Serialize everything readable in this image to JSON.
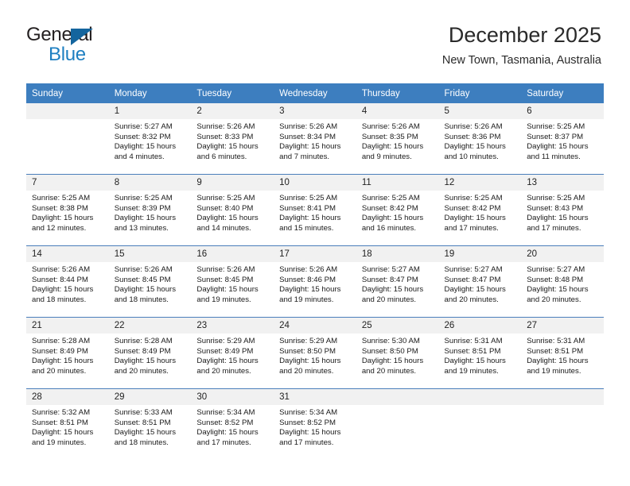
{
  "brand": {
    "name_part1": "General",
    "name_part2": "Blue",
    "triangle_color": "#14659e",
    "blue_color": "#1e7fc1"
  },
  "header": {
    "title": "December 2025",
    "subtitle": "New Town, Tasmania, Australia"
  },
  "theme": {
    "header_blue": "#3d7ebf",
    "row_divider": "#4a7ebb",
    "daynum_band": "#f1f1f1"
  },
  "calendar": {
    "weekday_headers": [
      "Sunday",
      "Monday",
      "Tuesday",
      "Wednesday",
      "Thursday",
      "Friday",
      "Saturday"
    ],
    "weeks": [
      [
        {
          "day": "",
          "sunrise": "",
          "sunset": "",
          "daylight1": "",
          "daylight2": ""
        },
        {
          "day": "1",
          "sunrise": "Sunrise: 5:27 AM",
          "sunset": "Sunset: 8:32 PM",
          "daylight1": "Daylight: 15 hours",
          "daylight2": "and 4 minutes."
        },
        {
          "day": "2",
          "sunrise": "Sunrise: 5:26 AM",
          "sunset": "Sunset: 8:33 PM",
          "daylight1": "Daylight: 15 hours",
          "daylight2": "and 6 minutes."
        },
        {
          "day": "3",
          "sunrise": "Sunrise: 5:26 AM",
          "sunset": "Sunset: 8:34 PM",
          "daylight1": "Daylight: 15 hours",
          "daylight2": "and 7 minutes."
        },
        {
          "day": "4",
          "sunrise": "Sunrise: 5:26 AM",
          "sunset": "Sunset: 8:35 PM",
          "daylight1": "Daylight: 15 hours",
          "daylight2": "and 9 minutes."
        },
        {
          "day": "5",
          "sunrise": "Sunrise: 5:26 AM",
          "sunset": "Sunset: 8:36 PM",
          "daylight1": "Daylight: 15 hours",
          "daylight2": "and 10 minutes."
        },
        {
          "day": "6",
          "sunrise": "Sunrise: 5:25 AM",
          "sunset": "Sunset: 8:37 PM",
          "daylight1": "Daylight: 15 hours",
          "daylight2": "and 11 minutes."
        }
      ],
      [
        {
          "day": "7",
          "sunrise": "Sunrise: 5:25 AM",
          "sunset": "Sunset: 8:38 PM",
          "daylight1": "Daylight: 15 hours",
          "daylight2": "and 12 minutes."
        },
        {
          "day": "8",
          "sunrise": "Sunrise: 5:25 AM",
          "sunset": "Sunset: 8:39 PM",
          "daylight1": "Daylight: 15 hours",
          "daylight2": "and 13 minutes."
        },
        {
          "day": "9",
          "sunrise": "Sunrise: 5:25 AM",
          "sunset": "Sunset: 8:40 PM",
          "daylight1": "Daylight: 15 hours",
          "daylight2": "and 14 minutes."
        },
        {
          "day": "10",
          "sunrise": "Sunrise: 5:25 AM",
          "sunset": "Sunset: 8:41 PM",
          "daylight1": "Daylight: 15 hours",
          "daylight2": "and 15 minutes."
        },
        {
          "day": "11",
          "sunrise": "Sunrise: 5:25 AM",
          "sunset": "Sunset: 8:42 PM",
          "daylight1": "Daylight: 15 hours",
          "daylight2": "and 16 minutes."
        },
        {
          "day": "12",
          "sunrise": "Sunrise: 5:25 AM",
          "sunset": "Sunset: 8:42 PM",
          "daylight1": "Daylight: 15 hours",
          "daylight2": "and 17 minutes."
        },
        {
          "day": "13",
          "sunrise": "Sunrise: 5:25 AM",
          "sunset": "Sunset: 8:43 PM",
          "daylight1": "Daylight: 15 hours",
          "daylight2": "and 17 minutes."
        }
      ],
      [
        {
          "day": "14",
          "sunrise": "Sunrise: 5:26 AM",
          "sunset": "Sunset: 8:44 PM",
          "daylight1": "Daylight: 15 hours",
          "daylight2": "and 18 minutes."
        },
        {
          "day": "15",
          "sunrise": "Sunrise: 5:26 AM",
          "sunset": "Sunset: 8:45 PM",
          "daylight1": "Daylight: 15 hours",
          "daylight2": "and 18 minutes."
        },
        {
          "day": "16",
          "sunrise": "Sunrise: 5:26 AM",
          "sunset": "Sunset: 8:45 PM",
          "daylight1": "Daylight: 15 hours",
          "daylight2": "and 19 minutes."
        },
        {
          "day": "17",
          "sunrise": "Sunrise: 5:26 AM",
          "sunset": "Sunset: 8:46 PM",
          "daylight1": "Daylight: 15 hours",
          "daylight2": "and 19 minutes."
        },
        {
          "day": "18",
          "sunrise": "Sunrise: 5:27 AM",
          "sunset": "Sunset: 8:47 PM",
          "daylight1": "Daylight: 15 hours",
          "daylight2": "and 20 minutes."
        },
        {
          "day": "19",
          "sunrise": "Sunrise: 5:27 AM",
          "sunset": "Sunset: 8:47 PM",
          "daylight1": "Daylight: 15 hours",
          "daylight2": "and 20 minutes."
        },
        {
          "day": "20",
          "sunrise": "Sunrise: 5:27 AM",
          "sunset": "Sunset: 8:48 PM",
          "daylight1": "Daylight: 15 hours",
          "daylight2": "and 20 minutes."
        }
      ],
      [
        {
          "day": "21",
          "sunrise": "Sunrise: 5:28 AM",
          "sunset": "Sunset: 8:49 PM",
          "daylight1": "Daylight: 15 hours",
          "daylight2": "and 20 minutes."
        },
        {
          "day": "22",
          "sunrise": "Sunrise: 5:28 AM",
          "sunset": "Sunset: 8:49 PM",
          "daylight1": "Daylight: 15 hours",
          "daylight2": "and 20 minutes."
        },
        {
          "day": "23",
          "sunrise": "Sunrise: 5:29 AM",
          "sunset": "Sunset: 8:49 PM",
          "daylight1": "Daylight: 15 hours",
          "daylight2": "and 20 minutes."
        },
        {
          "day": "24",
          "sunrise": "Sunrise: 5:29 AM",
          "sunset": "Sunset: 8:50 PM",
          "daylight1": "Daylight: 15 hours",
          "daylight2": "and 20 minutes."
        },
        {
          "day": "25",
          "sunrise": "Sunrise: 5:30 AM",
          "sunset": "Sunset: 8:50 PM",
          "daylight1": "Daylight: 15 hours",
          "daylight2": "and 20 minutes."
        },
        {
          "day": "26",
          "sunrise": "Sunrise: 5:31 AM",
          "sunset": "Sunset: 8:51 PM",
          "daylight1": "Daylight: 15 hours",
          "daylight2": "and 19 minutes."
        },
        {
          "day": "27",
          "sunrise": "Sunrise: 5:31 AM",
          "sunset": "Sunset: 8:51 PM",
          "daylight1": "Daylight: 15 hours",
          "daylight2": "and 19 minutes."
        }
      ],
      [
        {
          "day": "28",
          "sunrise": "Sunrise: 5:32 AM",
          "sunset": "Sunset: 8:51 PM",
          "daylight1": "Daylight: 15 hours",
          "daylight2": "and 19 minutes."
        },
        {
          "day": "29",
          "sunrise": "Sunrise: 5:33 AM",
          "sunset": "Sunset: 8:51 PM",
          "daylight1": "Daylight: 15 hours",
          "daylight2": "and 18 minutes."
        },
        {
          "day": "30",
          "sunrise": "Sunrise: 5:34 AM",
          "sunset": "Sunset: 8:52 PM",
          "daylight1": "Daylight: 15 hours",
          "daylight2": "and 17 minutes."
        },
        {
          "day": "31",
          "sunrise": "Sunrise: 5:34 AM",
          "sunset": "Sunset: 8:52 PM",
          "daylight1": "Daylight: 15 hours",
          "daylight2": "and 17 minutes."
        },
        {
          "day": "",
          "sunrise": "",
          "sunset": "",
          "daylight1": "",
          "daylight2": ""
        },
        {
          "day": "",
          "sunrise": "",
          "sunset": "",
          "daylight1": "",
          "daylight2": ""
        },
        {
          "day": "",
          "sunrise": "",
          "sunset": "",
          "daylight1": "",
          "daylight2": ""
        }
      ]
    ]
  }
}
